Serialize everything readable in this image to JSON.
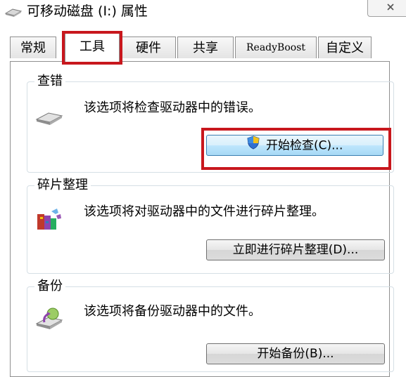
{
  "window": {
    "title": "可移动磁盘 (I:) 属性",
    "close_glyph": "✕"
  },
  "tabs": [
    {
      "label": "常规",
      "active": false
    },
    {
      "label": "工具",
      "active": true
    },
    {
      "label": "硬件",
      "active": false
    },
    {
      "label": "共享",
      "active": false
    },
    {
      "label": "ReadyBoost",
      "active": false
    },
    {
      "label": "自定义",
      "active": false
    }
  ],
  "groups": {
    "error_check": {
      "title": "查错",
      "description": "该选项将检查驱动器中的错误。",
      "button": "开始检查(C)...",
      "icon": "drive-icon"
    },
    "defrag": {
      "title": "碎片整理",
      "description": "该选项将对驱动器中的文件进行碎片整理。",
      "button": "立即进行碎片整理(D)...",
      "icon": "defrag-icon"
    },
    "backup": {
      "title": "备份",
      "description": "该选项将备份驱动器中的文件。",
      "button": "开始备份(B)...",
      "icon": "backup-icon"
    }
  },
  "colors": {
    "highlight_box": "#c8171d",
    "focused_button": "#3c7fb1"
  }
}
